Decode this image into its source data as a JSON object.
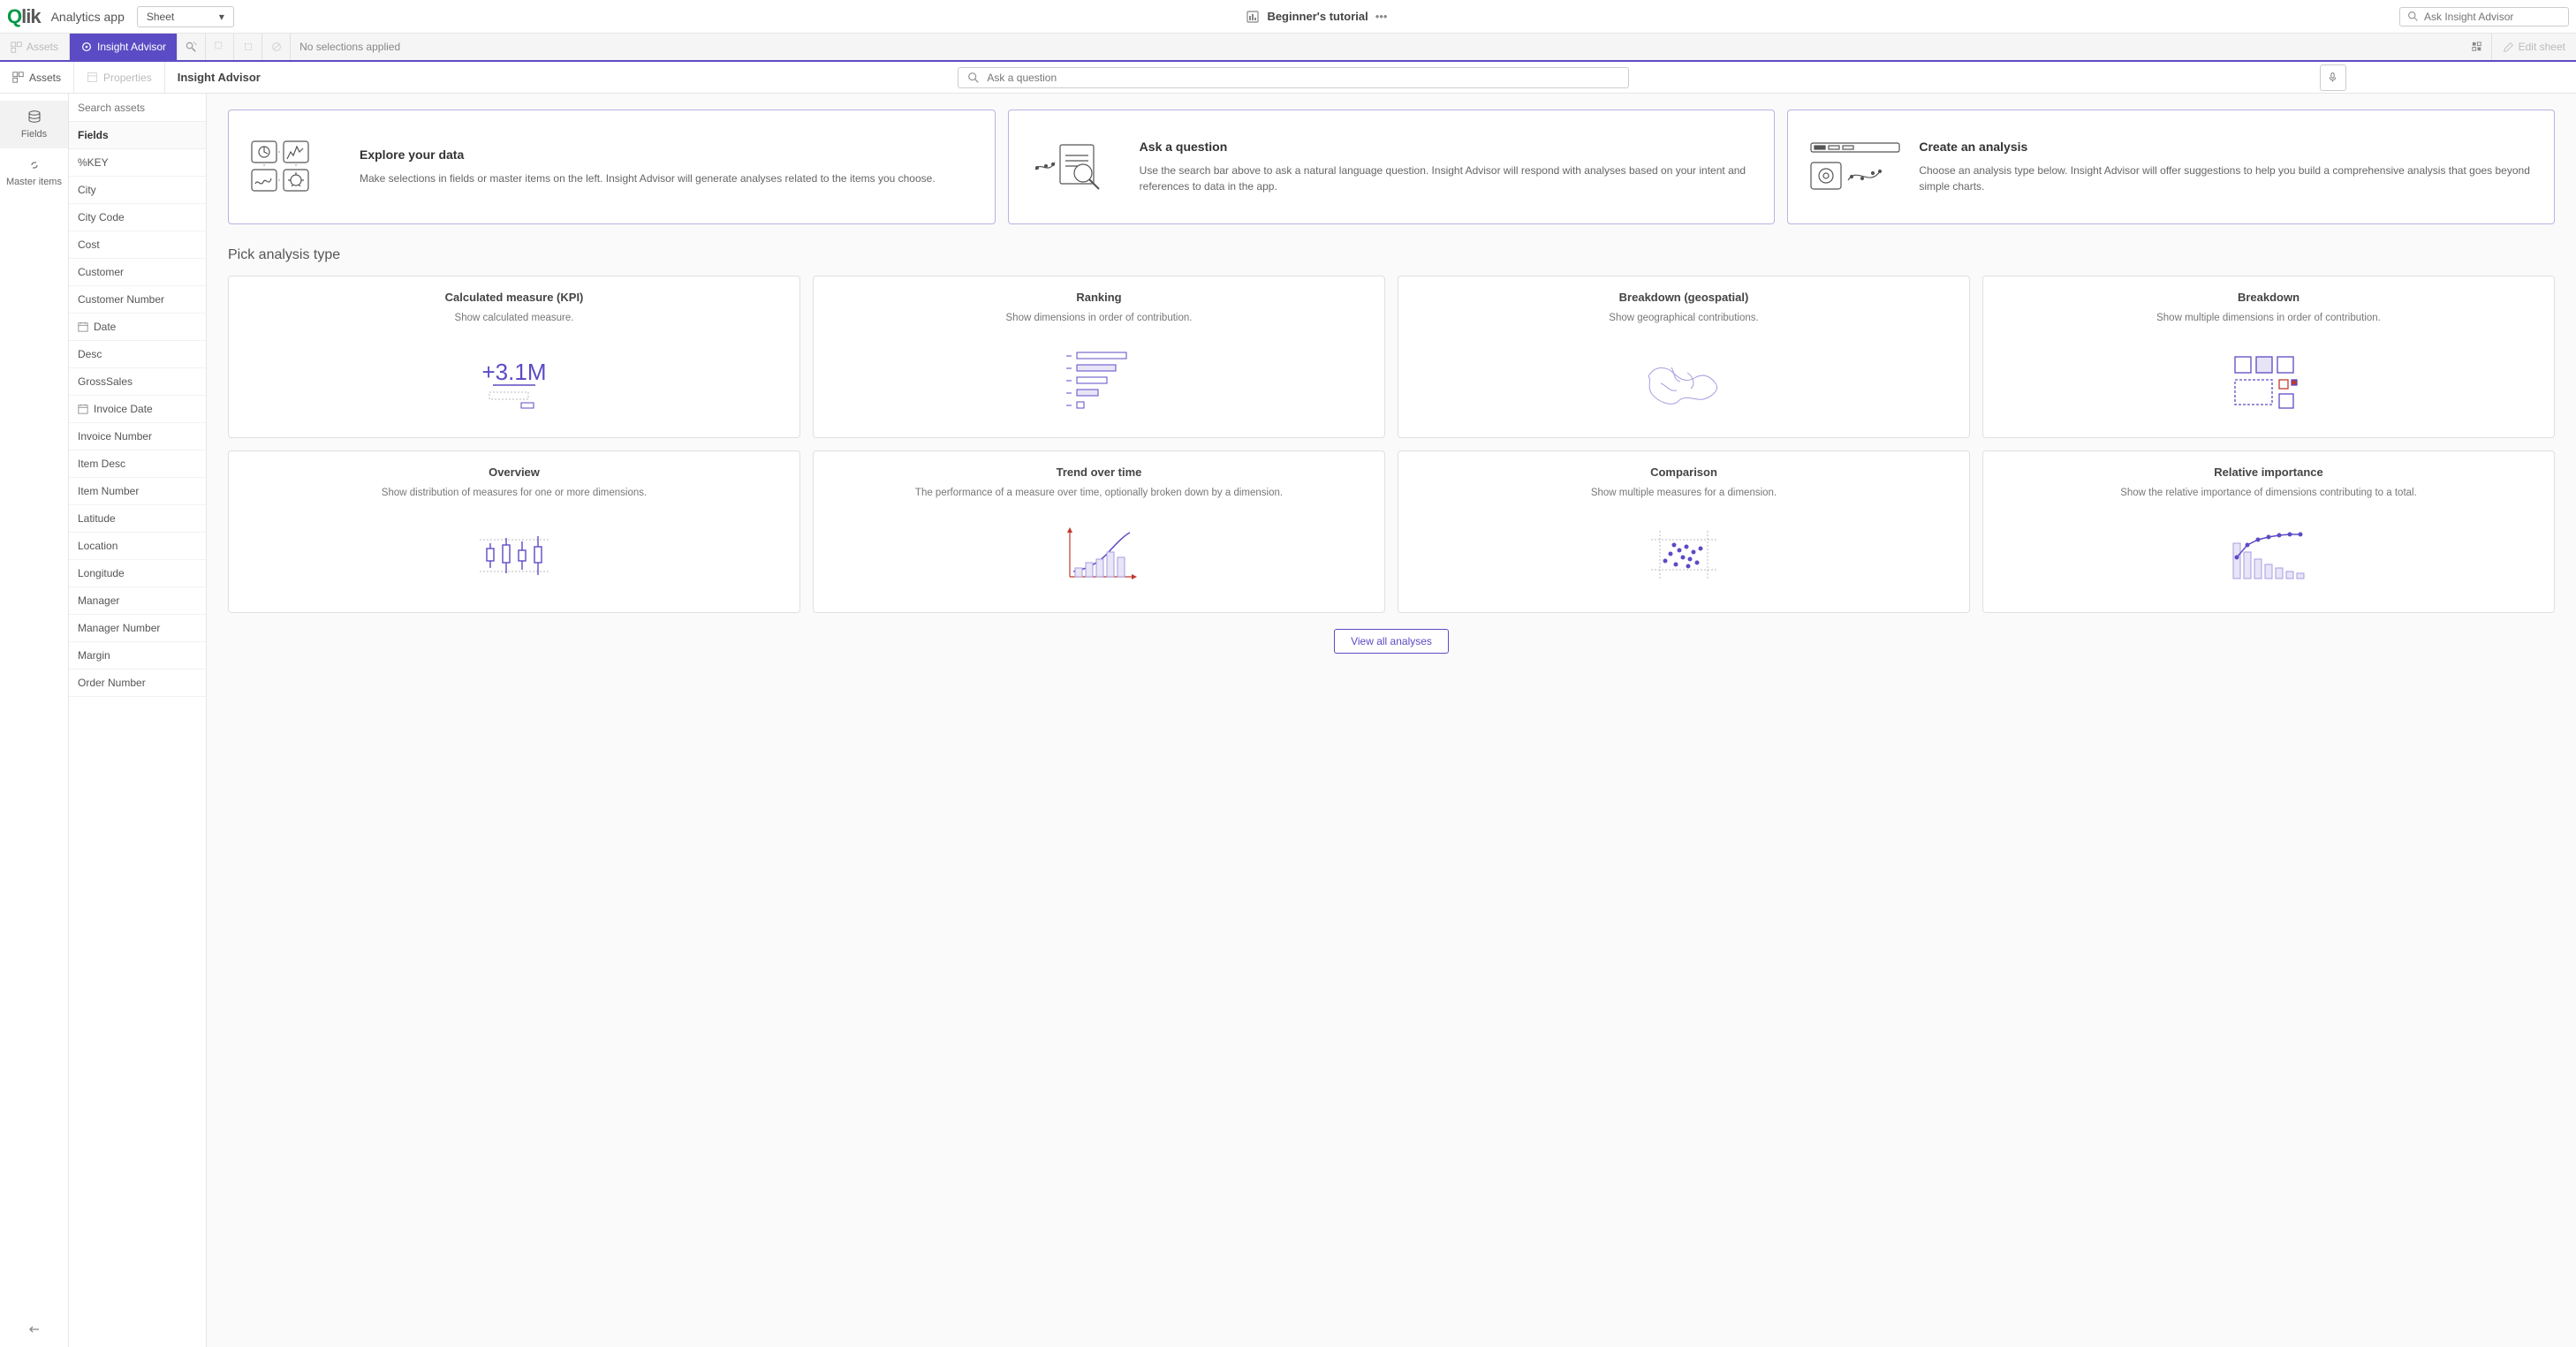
{
  "header": {
    "logo_text": "Qlik",
    "app_name": "Analytics app",
    "sheet_label": "Sheet",
    "tutorial_label": "Beginner's tutorial",
    "insight_search_placeholder": "Ask Insight Advisor"
  },
  "toolbar": {
    "assets": "Assets",
    "insight_advisor": "Insight Advisor",
    "no_selections": "No selections applied",
    "edit_sheet": "Edit sheet"
  },
  "subbar": {
    "assets": "Assets",
    "properties": "Properties",
    "title": "Insight Advisor",
    "ask_placeholder": "Ask a question"
  },
  "rail": {
    "fields": "Fields",
    "master_items": "Master items"
  },
  "fields_panel": {
    "search_placeholder": "Search assets",
    "header": "Fields",
    "items": [
      "%KEY",
      "City",
      "City Code",
      "Cost",
      "Customer",
      "Customer Number",
      "Date",
      "Desc",
      "GrossSales",
      "Invoice Date",
      "Invoice Number",
      "Item Desc",
      "Item Number",
      "Latitude",
      "Location",
      "Longitude",
      "Manager",
      "Manager Number",
      "Margin",
      "Order Number"
    ],
    "date_indices": [
      6,
      9
    ]
  },
  "intro_cards": [
    {
      "title": "Explore your data",
      "desc": "Make selections in fields or master items on the left. Insight Advisor will generate analyses related to the items you choose."
    },
    {
      "title": "Ask a question",
      "desc": "Use the search bar above to ask a natural language question. Insight Advisor will respond with analyses based on your intent and references to data in the app."
    },
    {
      "title": "Create an analysis",
      "desc": "Choose an analysis type below. Insight Advisor will offer suggestions to help you build a comprehensive analysis that goes beyond simple charts."
    }
  ],
  "section_title": "Pick analysis type",
  "analysis_cards": [
    {
      "title": "Calculated measure (KPI)",
      "desc": "Show calculated measure."
    },
    {
      "title": "Ranking",
      "desc": "Show dimensions in order of contribution."
    },
    {
      "title": "Breakdown (geospatial)",
      "desc": "Show geographical contributions."
    },
    {
      "title": "Breakdown",
      "desc": "Show multiple dimensions in order of contribution."
    },
    {
      "title": "Overview",
      "desc": "Show distribution of measures for one or more dimensions."
    },
    {
      "title": "Trend over time",
      "desc": "The performance of a measure over time, optionally broken down by a dimension."
    },
    {
      "title": "Comparison",
      "desc": "Show multiple measures for a dimension."
    },
    {
      "title": "Relative importance",
      "desc": "Show the relative importance of dimensions contributing to a total."
    }
  ],
  "view_all": "View all analyses"
}
